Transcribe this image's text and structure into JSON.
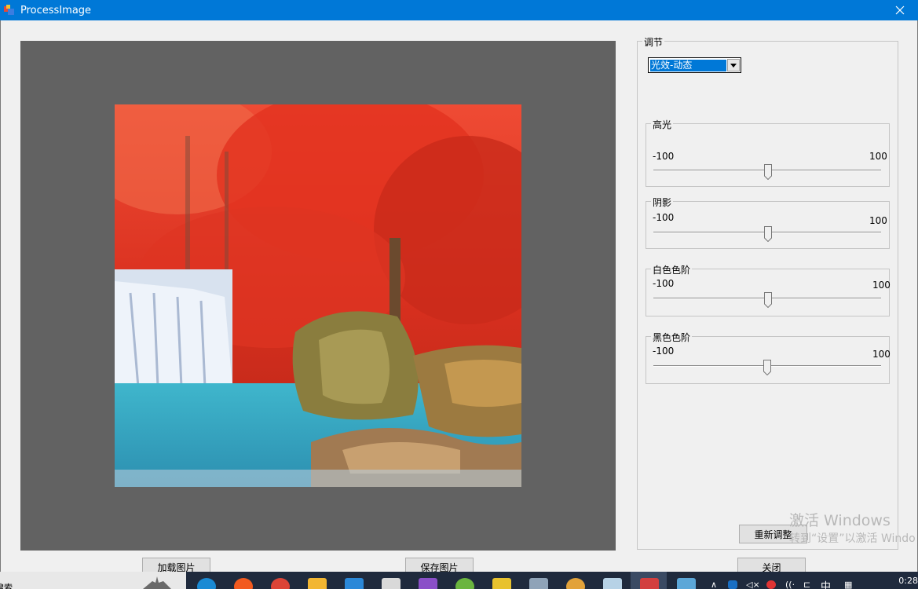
{
  "window": {
    "title": "ProcessImage"
  },
  "adjust_group": {
    "label": "调节",
    "mode_selected": "光效-动态"
  },
  "sliders": [
    {
      "label": "高光",
      "min": "-100",
      "max": "100",
      "value": 0
    },
    {
      "label": "阴影",
      "min": "-100",
      "max": "100",
      "value": 0
    },
    {
      "label": "白色色阶",
      "min": "-100",
      "max": "100",
      "value": 0
    },
    {
      "label": "黑色色阶",
      "min": "-100",
      "max": "100",
      "value": 0
    }
  ],
  "buttons": {
    "reset": "重新调整",
    "load": "加载图片",
    "save": "保存图片",
    "close": "关闭"
  },
  "watermark": {
    "line1": "激活 Windows",
    "line2": "转到“设置”以激活 Windo"
  },
  "taskbar": {
    "search_stub": "搜索",
    "ime": "中",
    "clock": "0:28"
  },
  "colors": {
    "titlebar": "#0078d7",
    "viewport": "#626262",
    "selection": "#0078d7"
  }
}
